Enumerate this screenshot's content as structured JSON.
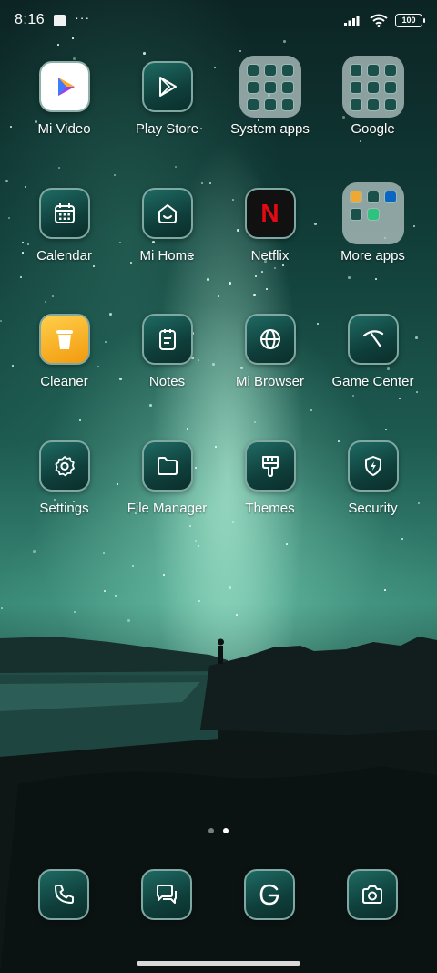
{
  "status_bar": {
    "time": "8:16",
    "more": "···",
    "battery": "100"
  },
  "apps": [
    {
      "label": "Mi Video",
      "icon": "mi-video-icon"
    },
    {
      "label": "Play Store",
      "icon": "play-store-icon"
    },
    {
      "label": "System apps",
      "icon": "folder-system-apps"
    },
    {
      "label": "Google",
      "icon": "folder-google"
    },
    {
      "label": "Calendar",
      "icon": "calendar-icon"
    },
    {
      "label": "Mi Home",
      "icon": "mi-home-icon"
    },
    {
      "label": "Netflix",
      "icon": "netflix-icon"
    },
    {
      "label": "More apps",
      "icon": "folder-more-apps"
    },
    {
      "label": "Cleaner",
      "icon": "cleaner-icon"
    },
    {
      "label": "Notes",
      "icon": "notes-icon"
    },
    {
      "label": "Mi Browser",
      "icon": "globe-icon"
    },
    {
      "label": "Game Center",
      "icon": "game-center-icon"
    },
    {
      "label": "Settings",
      "icon": "gear-icon"
    },
    {
      "label": "File Manager",
      "icon": "folder-icon"
    },
    {
      "label": "Themes",
      "icon": "brush-icon"
    },
    {
      "label": "Security",
      "icon": "shield-icon"
    }
  ],
  "dock": [
    {
      "icon": "phone-icon"
    },
    {
      "icon": "messages-icon"
    },
    {
      "icon": "google-g-icon"
    },
    {
      "icon": "camera-icon"
    }
  ],
  "netflix_letter": "N",
  "colors": {
    "icon_bg": "#0f3f3b",
    "icon_border": "#7fa8a2",
    "netflix_red": "#e50914"
  },
  "page": {
    "current": 2,
    "total": 2
  }
}
